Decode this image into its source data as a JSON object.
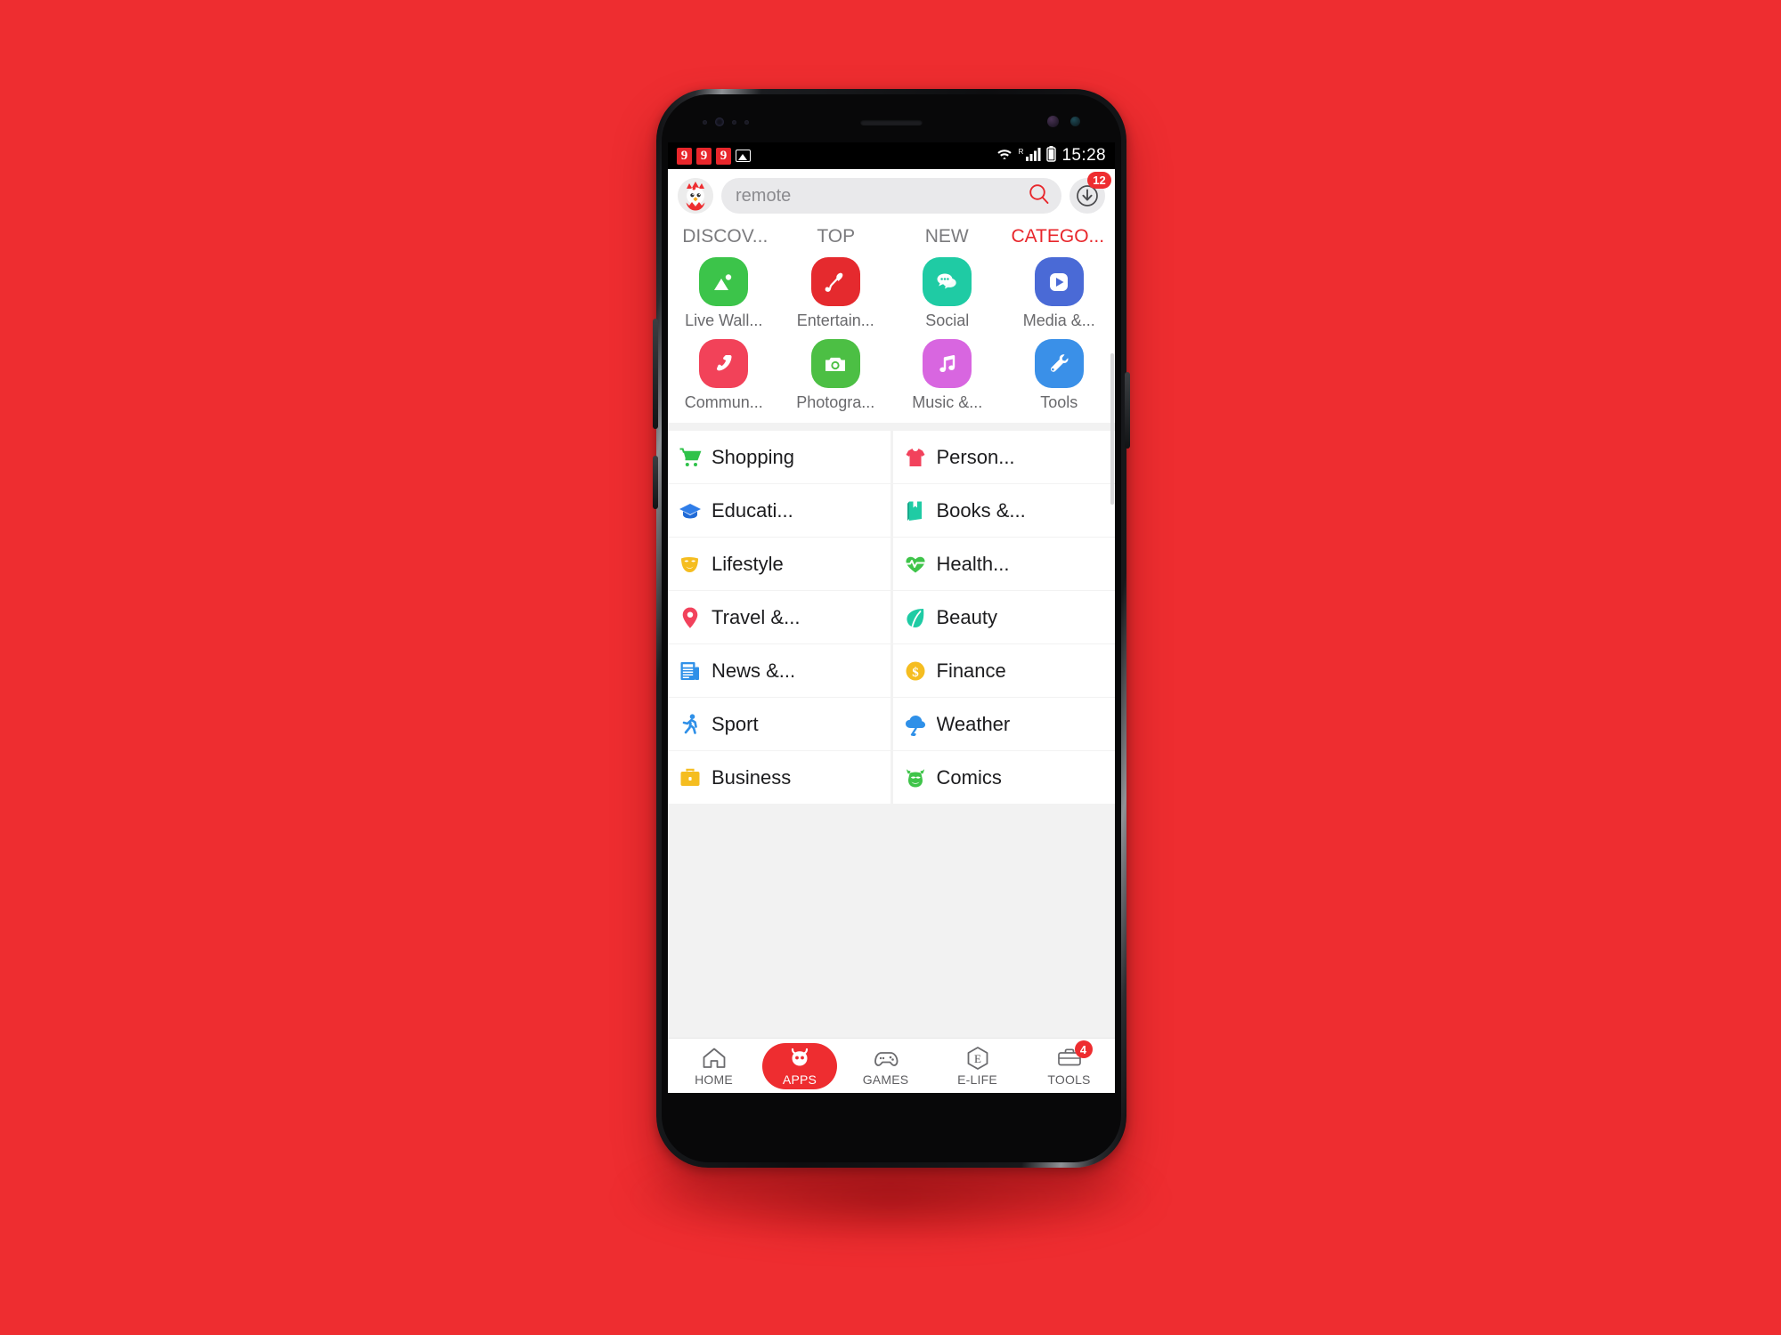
{
  "theme": {
    "background_color": "#ee2d30",
    "accent_color": "#ee2d30",
    "active_tab_color": "#e8262b"
  },
  "status_bar": {
    "notification_badges": [
      "9",
      "9",
      "9"
    ],
    "image_icon": "screenshot-icon",
    "wifi_icon": "wifi-icon",
    "roaming_label": "R",
    "signal_icon": "signal-bars-icon",
    "battery_icon": "battery-icon",
    "time": "15:28"
  },
  "header": {
    "avatar_name": "chick-avatar",
    "search": {
      "value": "remote",
      "placeholder": "remote",
      "icon": "search-icon"
    },
    "download_button": {
      "icon": "download-icon",
      "badge": "12"
    }
  },
  "tabs": [
    {
      "label": "DISCOV...",
      "active": false
    },
    {
      "label": "TOP",
      "active": false
    },
    {
      "label": "NEW",
      "active": false
    },
    {
      "label": "CATEGO...",
      "active": true
    }
  ],
  "grid": {
    "rows": [
      [
        {
          "label": "Live Wall...",
          "icon": "image-icon",
          "bg": "#3cc44a",
          "fg": "#ffffff"
        },
        {
          "label": "Entertain...",
          "icon": "microphone-icon",
          "bg": "#e52a2e",
          "fg": "#ffffff"
        },
        {
          "label": "Social",
          "icon": "chat-bubbles-icon",
          "bg": "#1fcba4",
          "fg": "#ffffff"
        },
        {
          "label": "Media &...",
          "icon": "play-button-icon",
          "bg": "#4a6ad6",
          "fg": "#ffffff"
        }
      ],
      [
        {
          "label": "Commun...",
          "icon": "phone-icon",
          "bg": "#f24259",
          "fg": "#ffffff"
        },
        {
          "label": "Photogra...",
          "icon": "camera-icon",
          "bg": "#4cbf44",
          "fg": "#ffffff"
        },
        {
          "label": "Music &...",
          "icon": "music-note-icon",
          "bg": "#d866e0",
          "fg": "#ffffff"
        },
        {
          "label": "Tools",
          "icon": "wrench-icon",
          "bg": "#3a90e8",
          "fg": "#ffffff"
        }
      ]
    ]
  },
  "category_list": {
    "rows": [
      [
        {
          "label": "Shopping",
          "icon": "shopping-cart-icon",
          "color": "#2fc24a"
        },
        {
          "label": "Person...",
          "icon": "tshirt-icon",
          "color": "#f2425c"
        }
      ],
      [
        {
          "label": "Educati...",
          "icon": "graduation-cap-icon",
          "color": "#2f7de8"
        },
        {
          "label": "Books &...",
          "icon": "book-icon",
          "color": "#1fcba4"
        }
      ],
      [
        {
          "label": "Lifestyle",
          "icon": "theater-mask-icon",
          "color": "#f5bd20"
        },
        {
          "label": "Health...",
          "icon": "heart-pulse-icon",
          "color": "#3fc44a"
        }
      ],
      [
        {
          "label": "Travel &...",
          "icon": "map-pin-icon",
          "color": "#f2425c"
        },
        {
          "label": "Beauty",
          "icon": "leaf-icon",
          "color": "#1fcba4"
        }
      ],
      [
        {
          "label": "News &...",
          "icon": "newspaper-icon",
          "color": "#2f90e8"
        },
        {
          "label": "Finance",
          "icon": "coin-dollar-icon",
          "color": "#f5bd20"
        }
      ],
      [
        {
          "label": "Sport",
          "icon": "runner-icon",
          "color": "#2f90e8"
        },
        {
          "label": "Weather",
          "icon": "storm-cloud-icon",
          "color": "#2f90e8"
        }
      ],
      [
        {
          "label": "Business",
          "icon": "briefcase-icon",
          "color": "#f5bd20"
        },
        {
          "label": "Comics",
          "icon": "devil-mask-icon",
          "color": "#3fc44a"
        }
      ]
    ]
  },
  "bottom_nav": [
    {
      "label": "HOME",
      "icon": "home-icon",
      "active": false,
      "badge": null
    },
    {
      "label": "APPS",
      "icon": "robot-face-icon",
      "active": true,
      "badge": null
    },
    {
      "label": "GAMES",
      "icon": "gamepad-icon",
      "active": false,
      "badge": null
    },
    {
      "label": "E-LIFE",
      "icon": "hexagon-e-icon",
      "active": false,
      "badge": null
    },
    {
      "label": "TOOLS",
      "icon": "toolbox-icon",
      "active": false,
      "badge": "4"
    }
  ]
}
